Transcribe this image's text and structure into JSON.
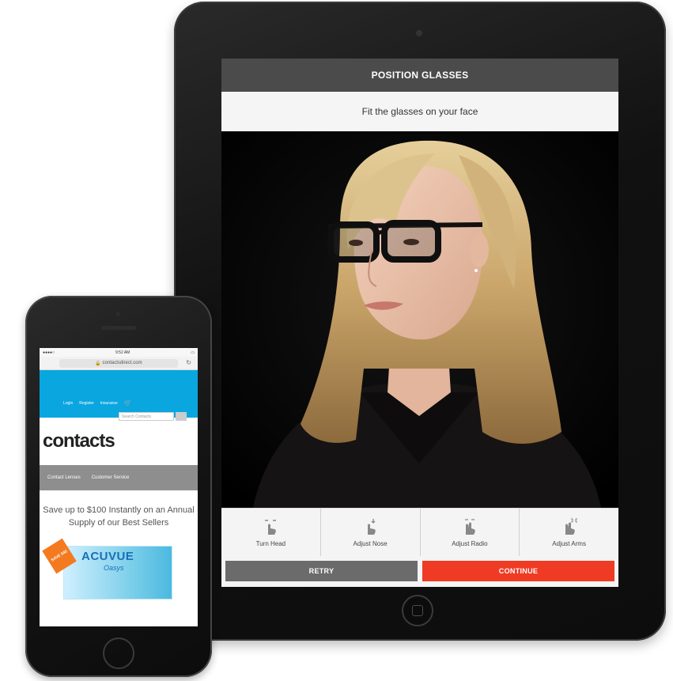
{
  "tablet": {
    "header": "POSITION GLASSES",
    "subheader": "Fit the glasses on your face",
    "tools": [
      {
        "label": "Turn Head",
        "icon": "turn-head-icon"
      },
      {
        "label": "Adjust Nose",
        "icon": "adjust-nose-icon"
      },
      {
        "label": "Adjust Radio",
        "icon": "adjust-radio-icon"
      },
      {
        "label": "Adjust Arms",
        "icon": "adjust-arms-icon"
      }
    ],
    "retry_label": "RETRY",
    "continue_label": "CONTINUE",
    "colors": {
      "continue": "#ef3b24",
      "retry": "#6b6b6b",
      "header": "#4b4b4b"
    }
  },
  "phone": {
    "status_time": "9:52 AM",
    "url": "contactsdirect.com",
    "links": [
      "Login",
      "Register",
      "Insurance"
    ],
    "search_placeholder": "Search Contacts",
    "logo": "contacts",
    "nav": [
      "Contact Lenses",
      "Customer Service"
    ],
    "promo": "Save up to $100 Instantly on an Annual Supply of our Best Sellers",
    "product_brand": "ACUVUE",
    "product_line": "Oasys",
    "ribbon": "SAVE $40",
    "colors": {
      "header_blue": "#0aa6df",
      "nav_gray": "#8e8e8e"
    }
  }
}
